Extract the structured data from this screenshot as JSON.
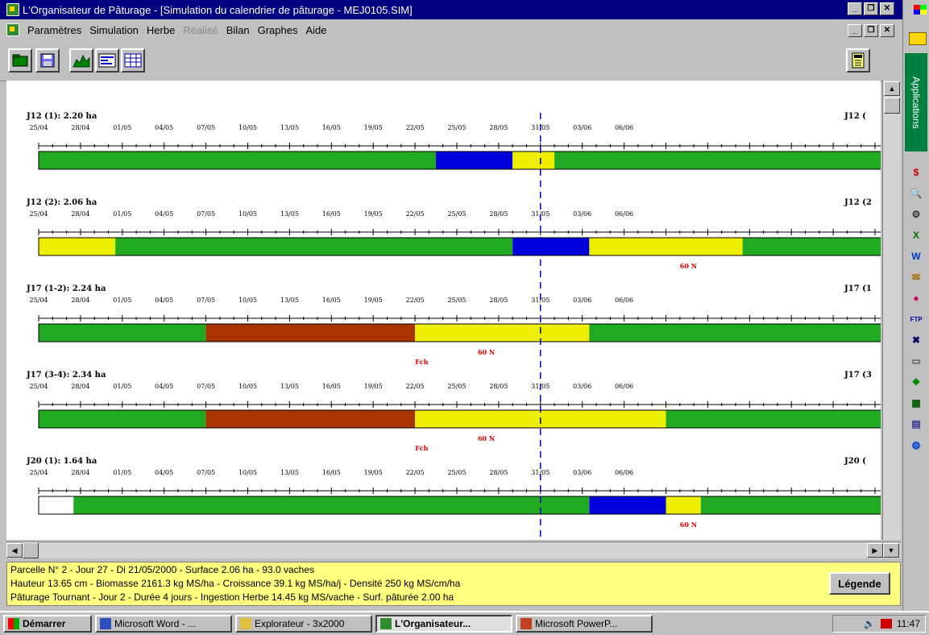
{
  "window": {
    "title": "L'Organisateur de Pâturage - [Simulation du calendrier de pâturage - MEJ0105.SIM]",
    "min_label": "_",
    "max_label": "❐",
    "close_label": "✕"
  },
  "menu": [
    "Paramètres",
    "Simulation",
    "Herbe",
    "Réalisé",
    "Bilan",
    "Graphes",
    "Aide"
  ],
  "toolbar": {
    "buttons": [
      "open-icon",
      "save-icon",
      "chart-icon",
      "diagram-icon",
      "table-icon",
      "calculator-icon"
    ]
  },
  "timeline": {
    "dates": [
      "25/04",
      "28/04",
      "01/05",
      "04/05",
      "07/05",
      "10/05",
      "13/05",
      "16/05",
      "19/05",
      "22/05",
      "25/05",
      "28/05",
      "31/05",
      "03/06",
      "06/06"
    ],
    "current_date_marker": "31/05",
    "colors": {
      "green": "#22aa22",
      "blue": "#0000dd",
      "yellow": "#eeee00",
      "brown": "#aa3300",
      "white": "#ffffff"
    }
  },
  "parcels": [
    {
      "label": "J12 (1): 2.20 ha",
      "right_label": "J12 (",
      "segments": [
        {
          "start": 0,
          "days": 28.5,
          "color": "green"
        },
        {
          "start": 28.5,
          "days": 5.5,
          "color": "blue"
        },
        {
          "start": 34,
          "days": 3,
          "color": "yellow"
        },
        {
          "start": 37,
          "days": 99,
          "color": "green"
        }
      ],
      "annotations": []
    },
    {
      "label": "J12 (2): 2.06 ha",
      "right_label": "J12 (2",
      "segments": [
        {
          "start": 0,
          "days": 5.5,
          "color": "yellow"
        },
        {
          "start": 5.5,
          "days": 28.5,
          "color": "green"
        },
        {
          "start": 34,
          "days": 5.5,
          "color": "blue"
        },
        {
          "start": 39.5,
          "days": 11,
          "color": "yellow"
        },
        {
          "start": 50.5,
          "days": 99,
          "color": "green"
        }
      ],
      "annotations": [
        {
          "text": "60 N",
          "day": 46
        }
      ]
    },
    {
      "label": "J17 (1-2): 2.24 ha",
      "right_label": "J17 (1",
      "segments": [
        {
          "start": 0,
          "days": 12,
          "color": "green"
        },
        {
          "start": 12,
          "days": 15,
          "color": "brown"
        },
        {
          "start": 27,
          "days": 12.5,
          "color": "yellow"
        },
        {
          "start": 39.5,
          "days": 99,
          "color": "green"
        }
      ],
      "annotations": [
        {
          "text": "Fch",
          "day": 27
        },
        {
          "text": "60 N",
          "day": 31.5
        }
      ]
    },
    {
      "label": "J17 (3-4): 2.34 ha",
      "right_label": "J17 (3",
      "segments": [
        {
          "start": 0,
          "days": 12,
          "color": "green"
        },
        {
          "start": 12,
          "days": 15,
          "color": "brown"
        },
        {
          "start": 27,
          "days": 18,
          "color": "yellow"
        },
        {
          "start": 45,
          "days": 99,
          "color": "green"
        }
      ],
      "annotations": [
        {
          "text": "Fch",
          "day": 27
        },
        {
          "text": "60 N",
          "day": 31.5
        }
      ]
    },
    {
      "label": "J20 (1): 1.64 ha",
      "right_label": "J20 (",
      "segments": [
        {
          "start": 0,
          "days": 2.5,
          "color": "white"
        },
        {
          "start": 2.5,
          "days": 37,
          "color": "green"
        },
        {
          "start": 39.5,
          "days": 5.5,
          "color": "blue"
        },
        {
          "start": 45,
          "days": 2.5,
          "color": "yellow"
        },
        {
          "start": 47.5,
          "days": 99,
          "color": "green"
        }
      ],
      "annotations": [
        {
          "text": "60 N",
          "day": 46
        }
      ]
    }
  ],
  "status": {
    "line1": "Parcelle N° 2 - Jour 27 - Di 21/05/2000 - Surface 2.06 ha - 93.0 vaches",
    "line2": "Hauteur 13.65 cm - Biomasse 2161.3 kg MS/ha - Croissance 39.1 kg MS/ha/j - Densité 250 kg MS/cm/ha",
    "line3": "Pâturage Tournant - Jour 2 - Durée 4 jours - Ingestion Herbe 14.45 kg MS/vache - Surf. pâturée 2.00 ha",
    "legend_button": "Légende"
  },
  "taskbar": {
    "start": "Démarrer",
    "tasks": [
      "Microsoft Word - ...",
      "Explorateur - 3x2000",
      "L'Organisateur...",
      "Microsoft PowerP..."
    ],
    "clock": "11:47"
  },
  "sidepanel": {
    "tab_label": "Applications",
    "icons": [
      "money-icon",
      "find-icon",
      "wrench-icon",
      "excel-icon",
      "word-icon",
      "mail-icon",
      "paint-icon",
      "ftp-icon",
      "close-x-icon",
      "scanner-icon",
      "organisateur-icon",
      "sheet-icon",
      "book-icon",
      "globe-icon"
    ]
  }
}
